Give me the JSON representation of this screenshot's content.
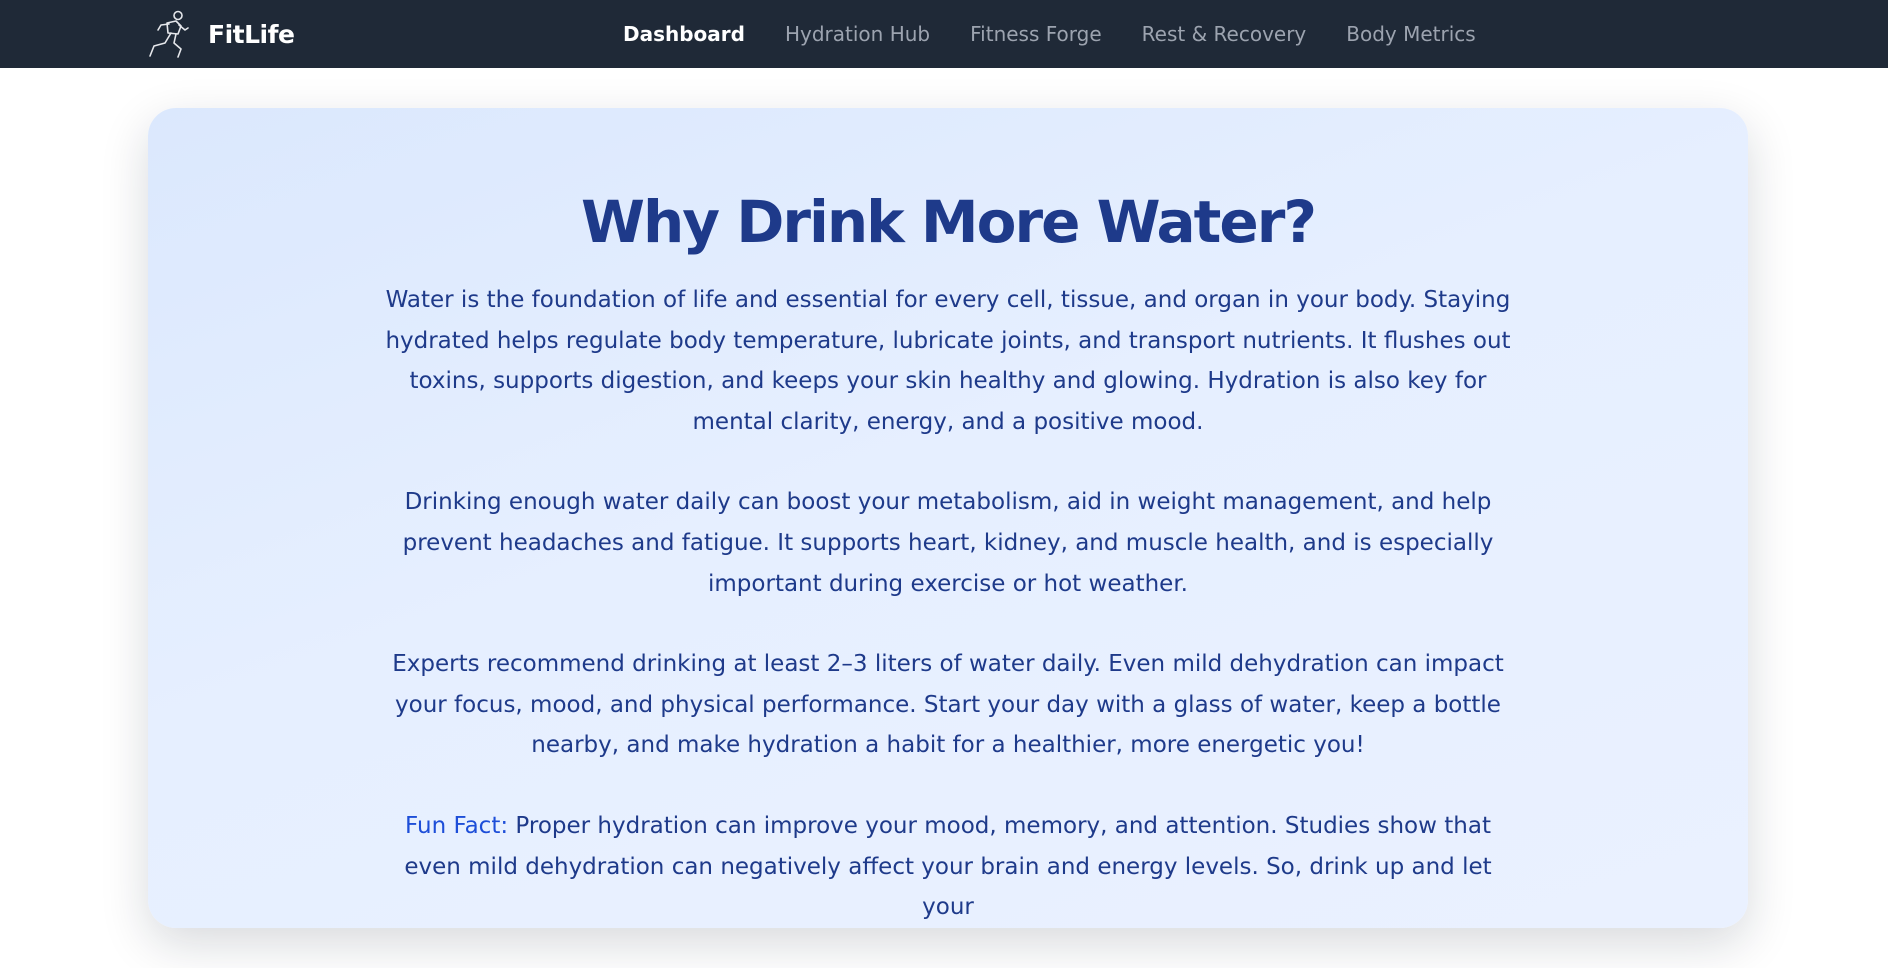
{
  "brand": {
    "name": "FitLife",
    "icon": "running-person-icon"
  },
  "nav": {
    "items": [
      {
        "label": "Dashboard",
        "active": true
      },
      {
        "label": "Hydration Hub",
        "active": false
      },
      {
        "label": "Fitness Forge",
        "active": false
      },
      {
        "label": "Rest & Recovery",
        "active": false
      },
      {
        "label": "Body Metrics",
        "active": false
      }
    ]
  },
  "main": {
    "title": "Why Drink More Water?",
    "paragraphs": [
      "Water is the foundation of life and essential for every cell, tissue, and organ in your body. Staying hydrated helps regulate body temperature, lubricate joints, and transport nutrients. It flushes out toxins, supports digestion, and keeps your skin healthy and glowing. Hydration is also key for mental clarity, energy, and a positive mood.",
      "Drinking enough water daily can boost your metabolism, aid in weight management, and help prevent headaches and fatigue. It supports heart, kidney, and muscle health, and is especially important during exercise or hot weather.",
      "Experts recommend drinking at least 2–3 liters of water daily. Even mild dehydration can impact your focus, mood, and physical performance. Start your day with a glass of water, keep a bottle nearby, and make hydration a habit for a healthier, more energetic you!"
    ],
    "fun_fact": {
      "label": "Fun Fact:",
      "text": " Proper hydration can improve your mood, memory, and attention. Studies show that even mild dehydration can negatively affect your brain and energy levels. So, drink up and let your"
    }
  },
  "colors": {
    "navbar_bg": "#1f2937",
    "nav_active": "#ffffff",
    "nav_inactive": "#9ca3af",
    "card_bg": "#e3edfe",
    "heading": "#1e3a8a",
    "fun_fact_label": "#1d4ed8"
  }
}
